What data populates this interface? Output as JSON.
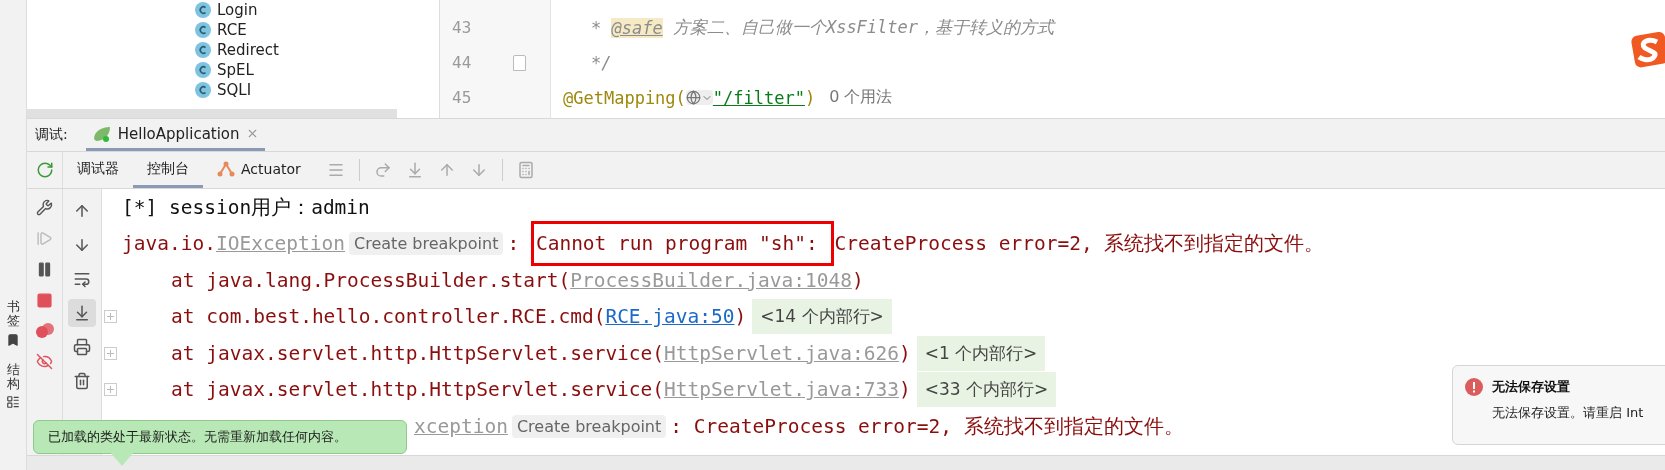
{
  "project_tree": {
    "items": [
      {
        "label": "Login"
      },
      {
        "label": "RCE"
      },
      {
        "label": "Redirect"
      },
      {
        "label": "SpEL"
      },
      {
        "label": "SQLI"
      }
    ]
  },
  "editor": {
    "lines": [
      {
        "number": "43",
        "segments": [
          {
            "kind": "comment",
            "text": "* "
          },
          {
            "kind": "doc_tag",
            "text": "@safe"
          },
          {
            "kind": "comment_cjk",
            "text": " 方案二、自己做一个XssFilter，基于转义的方式"
          }
        ]
      },
      {
        "number": "44",
        "fold": true,
        "segments": [
          {
            "kind": "comment",
            "text": "*/"
          }
        ]
      },
      {
        "number": "45",
        "segments": [
          {
            "kind": "annotation",
            "text": "@GetMapping("
          },
          {
            "kind": "globe"
          },
          {
            "kind": "string",
            "text": "\"/filter\""
          },
          {
            "kind": "annotation",
            "text": ")"
          },
          {
            "kind": "hint",
            "text": "0 个用法"
          }
        ]
      }
    ]
  },
  "side_labels": [
    "书签",
    "结构"
  ],
  "debug_bar": {
    "label": "调试:",
    "tabs": [
      {
        "label": "HelloApplication",
        "selected": true
      }
    ]
  },
  "toolbar_tabs": [
    {
      "label": "调试器",
      "selected": false
    },
    {
      "label": "控制台",
      "selected": true
    },
    {
      "label": "Actuator",
      "selected": false
    }
  ],
  "console_tools": [
    {
      "kind": "up",
      "selected": false
    },
    {
      "kind": "down",
      "selected": false
    },
    {
      "kind": "wrap",
      "selected": false
    },
    {
      "kind": "scroll_end",
      "selected": true
    },
    {
      "kind": "print",
      "selected": false
    },
    {
      "kind": "clear",
      "selected": false
    }
  ],
  "console": {
    "lines": [
      {
        "fold": false,
        "indent": false,
        "covered": false,
        "segments": [
          {
            "kind": "out",
            "text": "[*] session用户：admin"
          }
        ]
      },
      {
        "fold": false,
        "indent": false,
        "covered": false,
        "segments": [
          {
            "kind": "err",
            "text": "java.io."
          },
          {
            "kind": "file_link",
            "text": "IOException"
          },
          {
            "kind": "breakpoint_hint",
            "text": "Create breakpoint"
          },
          {
            "kind": "err",
            "text": ": "
          },
          {
            "kind": "boxed",
            "text": "Cannot run program \"sh\": "
          },
          {
            "kind": "err",
            "text": "CreateProcess error=2, 系统找不到指定的文件。"
          }
        ]
      },
      {
        "fold": false,
        "indent": true,
        "covered": false,
        "segments": [
          {
            "kind": "err",
            "text": "at java.lang.ProcessBuilder.start("
          },
          {
            "kind": "file_link",
            "text": "ProcessBuilder.java:1048"
          },
          {
            "kind": "err",
            "text": ")"
          }
        ]
      },
      {
        "fold": true,
        "indent": true,
        "covered": false,
        "segments": [
          {
            "kind": "err",
            "text": "at com.best.hello.controller.RCE.cmd("
          },
          {
            "kind": "src_link",
            "text": "RCE.java:50"
          },
          {
            "kind": "err",
            "text": ")"
          },
          {
            "kind": "collapsed",
            "text": "<14 个内部行>"
          }
        ]
      },
      {
        "fold": true,
        "indent": true,
        "covered": false,
        "segments": [
          {
            "kind": "err",
            "text": "at javax.servlet.http.HttpServlet.service("
          },
          {
            "kind": "file_link",
            "text": "HttpServlet.java:626"
          },
          {
            "kind": "err",
            "text": ")"
          },
          {
            "kind": "collapsed",
            "text": "<1 个内部行>"
          }
        ]
      },
      {
        "fold": true,
        "indent": true,
        "covered": false,
        "segments": [
          {
            "kind": "err",
            "text": "at javax.servlet.http.HttpServlet.service("
          },
          {
            "kind": "file_link",
            "text": "HttpServlet.java:733"
          },
          {
            "kind": "err",
            "text": ")"
          },
          {
            "kind": "collapsed",
            "text": "<33 个内部行>"
          }
        ]
      },
      {
        "fold": false,
        "indent": false,
        "covered": true,
        "segments": [
          {
            "kind": "file_link",
            "text": "xception"
          },
          {
            "kind": "breakpoint_hint",
            "text": "Create breakpoint"
          },
          {
            "kind": "err",
            "text": ": CreateProcess error=2, 系统找不到指定的文件。"
          }
        ]
      }
    ]
  },
  "tooltip": {
    "text": "已加载的类处于最新状态。无需重新加载任何内容。"
  },
  "notification": {
    "title": "无法保存设置",
    "body": "无法保存设置。请重启 Int"
  }
}
